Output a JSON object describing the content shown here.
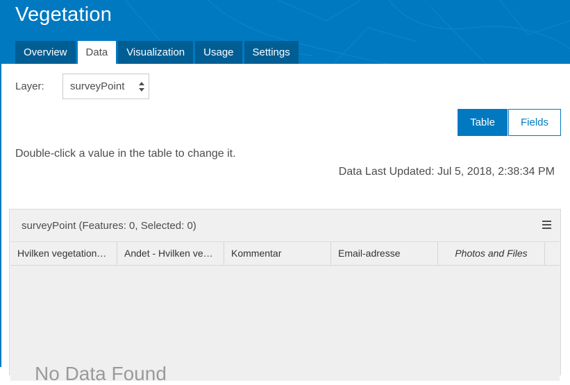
{
  "header": {
    "title": "Vegetation",
    "tabs": [
      "Overview",
      "Data",
      "Visualization",
      "Usage",
      "Settings"
    ],
    "active_tab": "Data"
  },
  "layer": {
    "label": "Layer:",
    "selected": "surveyPoint"
  },
  "view_toggle": {
    "table_label": "Table",
    "fields_label": "Fields",
    "active": "Table"
  },
  "hint_text": "Double-click a value in the table to change it.",
  "last_updated": "Data Last Updated: Jul 5, 2018, 2:38:34 PM",
  "table": {
    "title": "surveyPoint (Features: 0, Selected: 0)",
    "columns": [
      "Hvilken vegetationstype",
      "Andet - Hvilken vegetationstype",
      "Kommentar",
      "Email-adresse",
      "Photos and Files"
    ],
    "empty_text": "No Data Found"
  },
  "colors": {
    "brand_blue": "#0079c1",
    "tab_dark": "#005e95"
  }
}
